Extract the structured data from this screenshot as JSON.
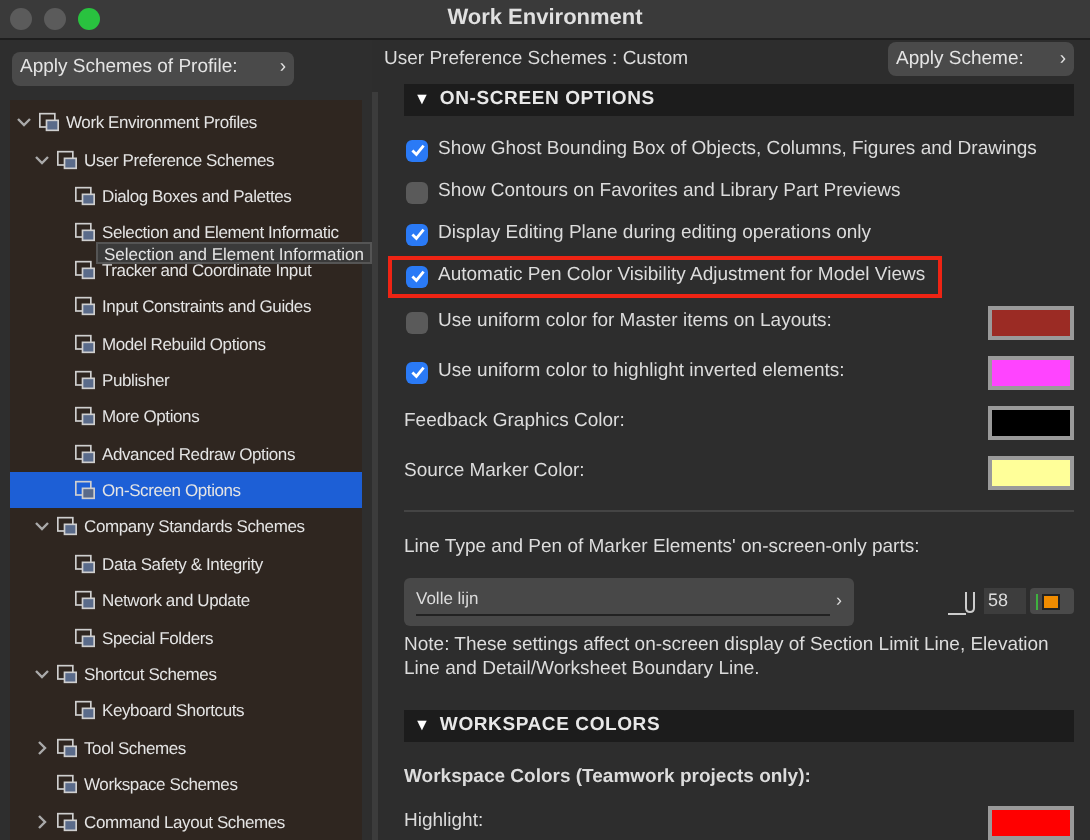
{
  "window": {
    "title": "Work Environment"
  },
  "left_bar": {
    "button": "Apply Schemes of Profile:",
    "button_glyph": "›"
  },
  "tree": [
    {
      "label": "Work Environment Profiles",
      "expanded": true,
      "selected": false,
      "children": [
        {
          "label": "User Preference Schemes",
          "expanded": true,
          "selected": false,
          "children": [
            {
              "label": "Dialog Boxes and Palettes",
              "selected": false
            },
            {
              "label": "Selection and Element Informatic",
              "selected": false
            },
            {
              "label": "Tracker and Coordinate Input",
              "selected": false
            },
            {
              "label": "Input Constraints and Guides",
              "selected": false
            },
            {
              "label": "Model Rebuild Options",
              "selected": false
            },
            {
              "label": "Publisher",
              "selected": false
            },
            {
              "label": "More Options",
              "selected": false
            },
            {
              "label": "Advanced Redraw Options",
              "selected": false
            },
            {
              "label": "On-Screen Options",
              "selected": true
            }
          ]
        },
        {
          "label": "Company Standards Schemes",
          "expanded": true,
          "selected": false,
          "children": [
            {
              "label": "Data Safety & Integrity",
              "selected": false
            },
            {
              "label": "Network and Update",
              "selected": false
            },
            {
              "label": "Special Folders",
              "selected": false
            }
          ]
        },
        {
          "label": "Shortcut Schemes",
          "expanded": true,
          "selected": false,
          "children": [
            {
              "label": "Keyboard Shortcuts",
              "selected": false
            }
          ]
        },
        {
          "label": "Tool Schemes",
          "expanded": false,
          "selected": false
        },
        {
          "label": "Workspace Schemes",
          "selected": false
        },
        {
          "label": "Command Layout Schemes",
          "expanded": false,
          "selected": false
        }
      ]
    }
  ],
  "tooltip": "Selection and Element Information",
  "header": {
    "scheme": "User Preference Schemes : Custom",
    "button": "Apply Scheme:",
    "button_glyph": "›"
  },
  "section_1": {
    "glyph": "▼",
    "title": "ON-SCREEN OPTIONS",
    "expanded": true
  },
  "options": [
    {
      "kind": "checkbox",
      "label": "Show Ghost Bounding Box of Objects, Columns, Figures and Drawings",
      "checked": true,
      "highlighted": false
    },
    {
      "kind": "checkbox",
      "label": "Show Contours on Favorites and Library Part Previews",
      "checked": false,
      "highlighted": false
    },
    {
      "kind": "checkbox",
      "label": "Display Editing Plane during editing operations only",
      "checked": true,
      "highlighted": false
    },
    {
      "kind": "checkbox",
      "label": "Automatic Pen Color Visibility Adjustment for Model Views",
      "checked": true,
      "highlighted": true
    },
    {
      "kind": "checkbox",
      "label": "Use uniform color for Master items on Layouts:",
      "checked": false,
      "highlighted": false,
      "color": "#9b2b24"
    },
    {
      "kind": "checkbox",
      "label": "Use uniform color to highlight inverted elements:",
      "checked": true,
      "highlighted": false,
      "color": "#ff44ff"
    },
    {
      "kind": "color",
      "label": "Feedback Graphics Color:",
      "color": "#000000"
    },
    {
      "kind": "color",
      "label": "Source Marker Color:",
      "color": "#ffff99"
    }
  ],
  "line_type": {
    "label": "Line Type and Pen of Marker Elements' on-screen-only parts:",
    "dropdown": "Volle lijn",
    "dropdown_glyph": "›",
    "pen": "58"
  },
  "note": "Note: These settings affect on-screen display of Section Limit Line, Elevation Line and Detail/Worksheet Boundary Line.",
  "section_2": {
    "glyph": "▼",
    "title": "WORKSPACE COLORS",
    "expanded": true
  },
  "workspace": {
    "title": "Workspace Colors (Teamwork projects only):",
    "items": [
      {
        "label": "Highlight:",
        "color": "#ff0000"
      }
    ]
  }
}
